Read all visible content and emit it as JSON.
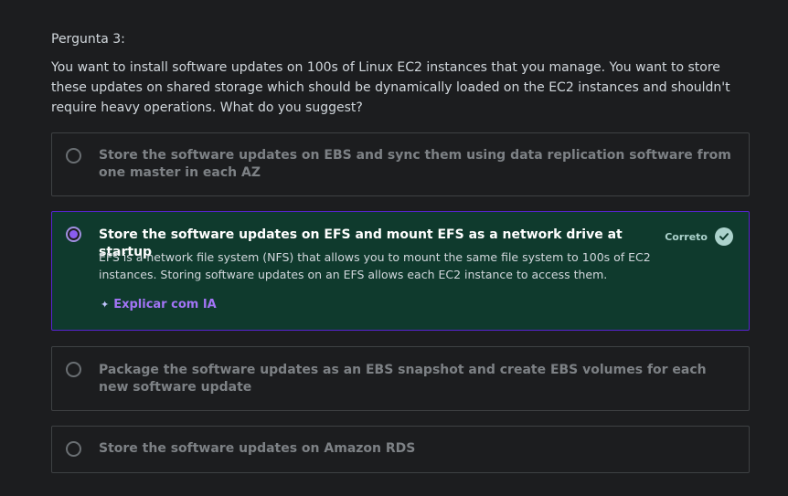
{
  "question": {
    "label": "Pergunta 3:",
    "text": "You want to install software updates on 100s of Linux EC2 instances that you manage. You want to store these updates on shared storage which should be dynamically loaded on the EC2 instances and shouldn't require heavy operations. What do you suggest?"
  },
  "options": [
    {
      "text": "Store the software updates on EBS and sync them using data replication software from one master in each AZ",
      "selected": false
    },
    {
      "text": "Store the software updates on EFS and mount EFS as a network drive at startup",
      "selected": true,
      "status": "Correto",
      "explanation": "EFS is a network file system (NFS) that allows you to mount the same file system to 100s of EC2 instances. Storing software updates on an EFS allows each EC2 instance to access them.",
      "ai_label": "Explicar com IA"
    },
    {
      "text": "Package the software updates as an EBS snapshot and create EBS volumes for each new software update",
      "selected": false
    },
    {
      "text": "Store the software updates on Amazon RDS",
      "selected": false
    }
  ],
  "colors": {
    "background": "#1c1d1f",
    "selected_bg": "#0f3a2d",
    "selected_border": "#5624d0",
    "correct": "#acd2cc",
    "ai_link": "#a274f5"
  },
  "icons": {
    "status": "check-circle-icon",
    "ai": "sparkle-icon"
  }
}
